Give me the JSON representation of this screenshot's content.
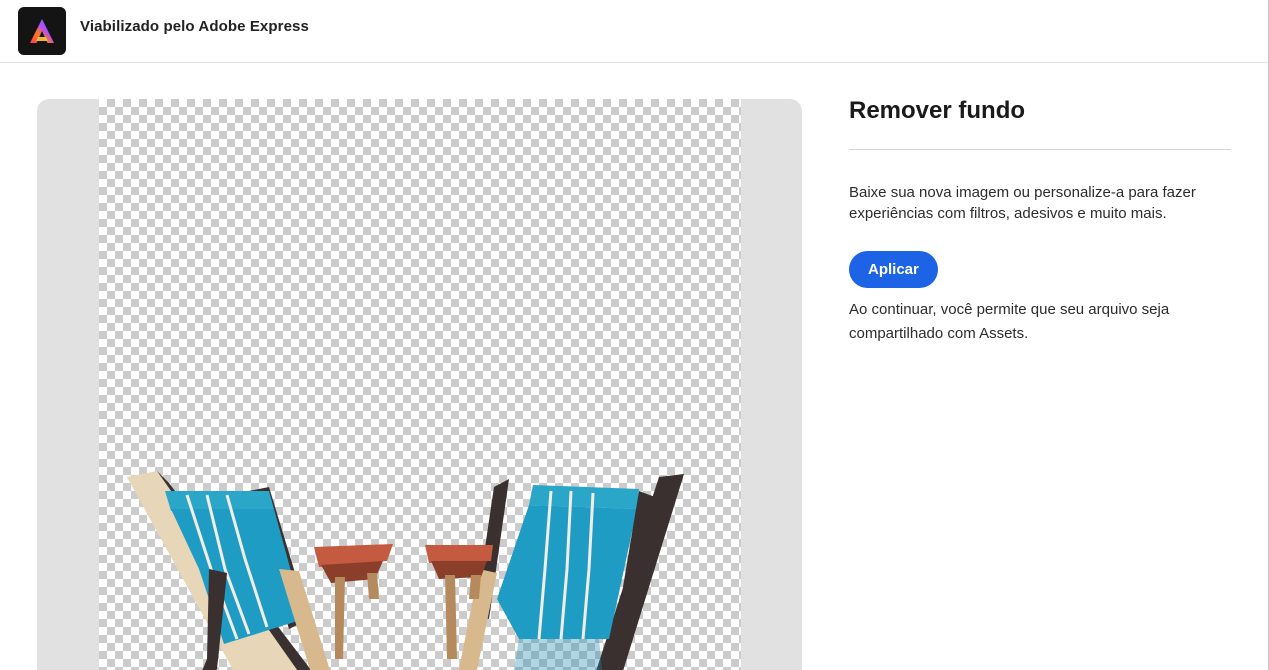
{
  "header": {
    "title": "Viabilizado pelo Adobe Express",
    "logo_icon": "adobe-express-logo-icon"
  },
  "preview": {
    "background_color": "#e1e1e1",
    "image_subject": "two-beach-chairs-cutout-icon"
  },
  "panel": {
    "title": "Remover fundo",
    "description": "Baixe sua nova imagem ou personalize-a para fazer experiências com filtros, adesivos e muito mais.",
    "apply_label": "Aplicar",
    "note": "Ao continuar, você permite que seu arquivo seja compartilhado com Assets."
  },
  "colors": {
    "accent": "#1c63e6",
    "logo_bg": "#141414"
  }
}
